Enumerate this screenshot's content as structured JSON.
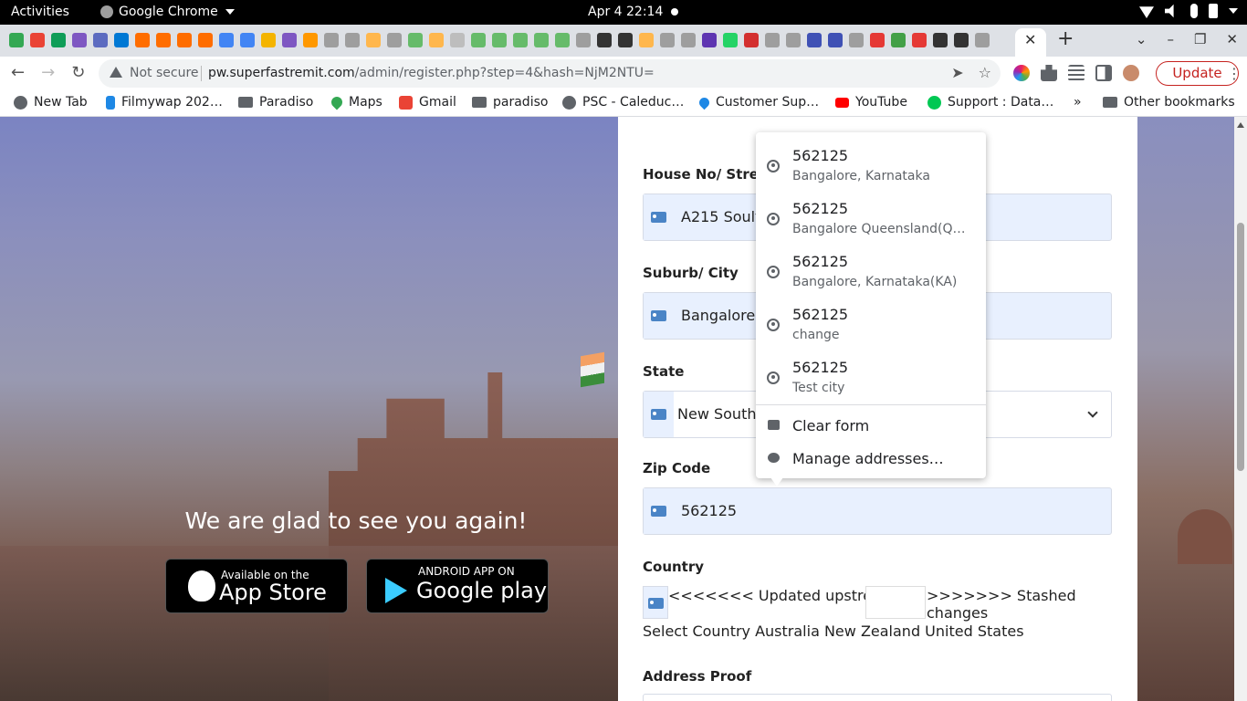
{
  "system": {
    "activities": "Activities",
    "app_name": "Google Chrome",
    "clock": "Apr 4  22:14"
  },
  "tabs": {
    "favicon_colors": [
      "#34a853",
      "#ea4335",
      "#0f9d58",
      "#7e57c2",
      "#5c6bc0",
      "#0078d4",
      "#ff6d00",
      "#ff6d00",
      "#ff6d00",
      "#ff6d00",
      "#4285f4",
      "#4285f4",
      "#f4b400",
      "#7e57c2",
      "#ff9800",
      "#9e9e9e",
      "#9e9e9e",
      "#ffb74d",
      "#9e9e9e",
      "#66bb6a",
      "#ffb74d",
      "#bdbdbd",
      "#66bb6a",
      "#66bb6a",
      "#66bb6a",
      "#66bb6a",
      "#66bb6a",
      "#9e9e9e",
      "#333333",
      "#333333",
      "#ffb74d",
      "#9e9e9e",
      "#9e9e9e",
      "#5e35b1",
      "#25d366",
      "#d32f2f",
      "#9e9e9e",
      "#9e9e9e",
      "#3f51b5",
      "#3f51b5",
      "#9e9e9e",
      "#e53935",
      "#43a047",
      "#e53935",
      "#333333",
      "#333333",
      "#9e9e9e"
    ]
  },
  "toolbar": {
    "security_label": "Not secure",
    "url_host": "pw.superfastremit.com",
    "url_path": "/admin/register.php?step=4&hash=NjM2NTU=",
    "update_label": "Update"
  },
  "bookmarks": [
    {
      "label": "New Tab",
      "icon": "globe-icon",
      "color": "#5f6368"
    },
    {
      "label": "Filmywap 202…",
      "icon": "filmywap-icon",
      "color": "#1e88e5"
    },
    {
      "label": "Paradiso",
      "icon": "folder-icon",
      "color": "#5f6368"
    },
    {
      "label": "Maps",
      "icon": "maps-icon",
      "color": "#34a853"
    },
    {
      "label": "Gmail",
      "icon": "gmail-icon",
      "color": "#ea4335"
    },
    {
      "label": "paradiso",
      "icon": "folder-icon",
      "color": "#5f6368"
    },
    {
      "label": "PSC - Caleduc…",
      "icon": "globe-icon",
      "color": "#5f6368"
    },
    {
      "label": "Customer Sup…",
      "icon": "support-icon",
      "color": "#1e88e5"
    },
    {
      "label": "YouTube",
      "icon": "youtube-icon",
      "color": "#ff0000"
    },
    {
      "label": "Support : Data…",
      "icon": "support-data-icon",
      "color": "#00c853"
    },
    {
      "label": "»",
      "icon": "",
      "color": ""
    },
    {
      "label": "Other bookmarks",
      "icon": "folder-icon",
      "color": "#5f6368"
    }
  ],
  "hero": {
    "tagline": "We are glad to see you again!",
    "appstore_small": "Available on the",
    "appstore_big": "App Store",
    "googleplay_small": "ANDROID APP ON",
    "googleplay_big": "Google play"
  },
  "form": {
    "street_label": "House No/ Street",
    "street_value": "A215 Soultr",
    "city_label": "Suburb/ City",
    "city_value": "Bangalore",
    "state_label": "State",
    "state_value": "New South",
    "zip_label": "Zip Code",
    "zip_value": "562125",
    "country_label": "Country",
    "country_conflict_a": "<<<<<<< Updated upstream",
    "country_conflict_b": ">>>>>>> Stashed changes",
    "country_options": "Select Country Australia New Zealand United States",
    "address_proof_label": "Address Proof"
  },
  "autofill": {
    "suggestions": [
      {
        "value": "562125",
        "sub": "Bangalore, Karnataka"
      },
      {
        "value": "562125",
        "sub": "Bangalore Queensland(Q…"
      },
      {
        "value": "562125",
        "sub": "Bangalore, Karnataka(KA)"
      },
      {
        "value": "562125",
        "sub": "change"
      },
      {
        "value": "562125",
        "sub": "Test city"
      }
    ],
    "clear_form": "Clear form",
    "manage_addresses": "Manage addresses…"
  }
}
